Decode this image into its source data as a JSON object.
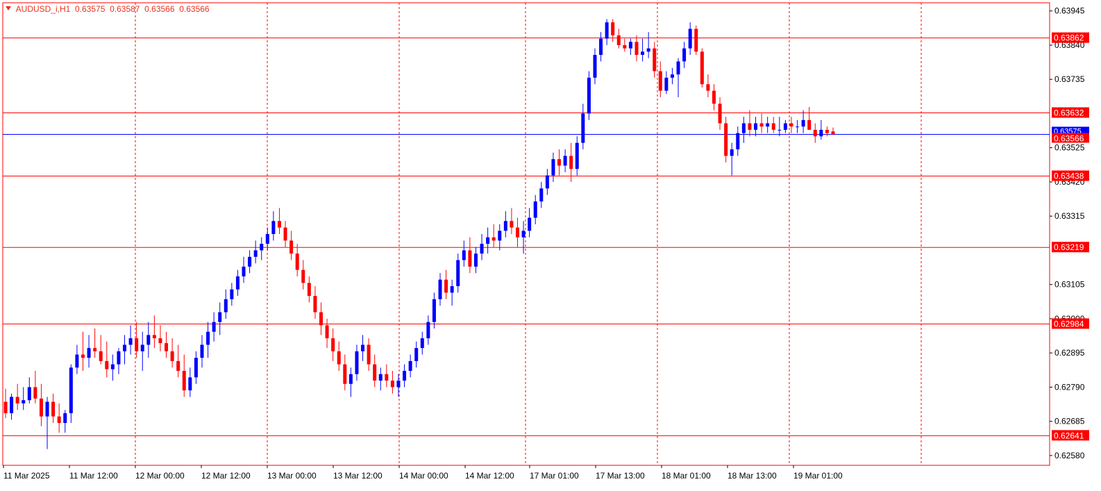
{
  "header": {
    "symbol": "AUDUSD_i,H1",
    "open": "0.63575",
    "high": "0.63587",
    "low": "0.63566",
    "close": "0.63566"
  },
  "colors": {
    "bull": "#0000ff",
    "bear": "#ff0000",
    "grid": "#ff0000",
    "level": "#ff0000",
    "bid": "#0000ff",
    "text": "#000000"
  },
  "chart_data": {
    "type": "candlestick",
    "x_labels": [
      "11 Mar 2025",
      "11 Mar 12:00",
      "12 Mar 00:00",
      "12 Mar 12:00",
      "13 Mar 00:00",
      "13 Mar 12:00",
      "14 Mar 00:00",
      "14 Mar 12:00",
      "17 Mar 01:00",
      "17 Mar 13:00",
      "18 Mar 01:00",
      "18 Mar 13:00",
      "19 Mar 01:00"
    ],
    "y_ticks": [
      0.63945,
      0.6384,
      0.63735,
      0.63525,
      0.6342,
      0.63315,
      0.63105,
      0.63,
      0.62895,
      0.6279,
      0.62685,
      0.6258
    ],
    "ylim": [
      0.6255,
      0.6397
    ],
    "levels": [
      0.63862,
      0.63632,
      0.63438,
      0.63219,
      0.62984,
      0.62641
    ],
    "current_price": 0.63566,
    "current_price_label": "0.63566",
    "current_price_overlapped_label": "0.63575",
    "series": [
      {
        "name": "AUDUSD_i,H1",
        "ohlc": [
          [
            0.62745,
            0.62785,
            0.62695,
            0.6271
          ],
          [
            0.6271,
            0.6277,
            0.6269,
            0.6276
          ],
          [
            0.6276,
            0.628,
            0.6272,
            0.6274
          ],
          [
            0.6274,
            0.6279,
            0.6272,
            0.6275
          ],
          [
            0.6275,
            0.6282,
            0.6274,
            0.6279
          ],
          [
            0.6279,
            0.6284,
            0.6274,
            0.62755
          ],
          [
            0.62755,
            0.628,
            0.6267,
            0.627
          ],
          [
            0.627,
            0.6276,
            0.626,
            0.62745
          ],
          [
            0.62745,
            0.6277,
            0.6268,
            0.627
          ],
          [
            0.627,
            0.6274,
            0.6265,
            0.6268
          ],
          [
            0.6268,
            0.6272,
            0.6265,
            0.6271
          ],
          [
            0.6271,
            0.6286,
            0.6268,
            0.6285
          ],
          [
            0.6285,
            0.6292,
            0.6283,
            0.6289
          ],
          [
            0.6289,
            0.6296,
            0.6284,
            0.6288
          ],
          [
            0.6288,
            0.6295,
            0.6285,
            0.6291
          ],
          [
            0.6291,
            0.6297,
            0.6288,
            0.629
          ],
          [
            0.629,
            0.6295,
            0.6286,
            0.6287
          ],
          [
            0.6287,
            0.6293,
            0.6282,
            0.62845
          ],
          [
            0.62845,
            0.6289,
            0.6281,
            0.6286
          ],
          [
            0.6286,
            0.6291,
            0.6283,
            0.629
          ],
          [
            0.629,
            0.6295,
            0.6286,
            0.6292
          ],
          [
            0.6292,
            0.6298,
            0.6289,
            0.6294
          ],
          [
            0.6294,
            0.6299,
            0.6288,
            0.629
          ],
          [
            0.629,
            0.6296,
            0.6284,
            0.6292
          ],
          [
            0.6292,
            0.6299,
            0.6288,
            0.6295
          ],
          [
            0.6295,
            0.6301,
            0.6291,
            0.6294
          ],
          [
            0.6294,
            0.6298,
            0.629,
            0.62925
          ],
          [
            0.62925,
            0.6296,
            0.6288,
            0.629
          ],
          [
            0.629,
            0.6294,
            0.6285,
            0.6287
          ],
          [
            0.6287,
            0.6292,
            0.6282,
            0.6284
          ],
          [
            0.6284,
            0.6289,
            0.6276,
            0.6278
          ],
          [
            0.6278,
            0.6285,
            0.6276,
            0.6282
          ],
          [
            0.6282,
            0.629,
            0.628,
            0.6288
          ],
          [
            0.6288,
            0.6295,
            0.6285,
            0.6292
          ],
          [
            0.6292,
            0.6299,
            0.6288,
            0.6296
          ],
          [
            0.6296,
            0.6302,
            0.6293,
            0.6299
          ],
          [
            0.6299,
            0.6305,
            0.6295,
            0.6302
          ],
          [
            0.6302,
            0.6309,
            0.63,
            0.6306
          ],
          [
            0.6306,
            0.6311,
            0.6304,
            0.6309
          ],
          [
            0.6309,
            0.6315,
            0.6307,
            0.6313
          ],
          [
            0.6313,
            0.6319,
            0.6311,
            0.6316
          ],
          [
            0.6316,
            0.6321,
            0.6314,
            0.6319
          ],
          [
            0.6319,
            0.6324,
            0.6317,
            0.6321
          ],
          [
            0.6321,
            0.6325,
            0.6318,
            0.6323
          ],
          [
            0.6323,
            0.6328,
            0.6321,
            0.6326
          ],
          [
            0.6326,
            0.6333,
            0.6324,
            0.633
          ],
          [
            0.633,
            0.6334,
            0.6326,
            0.6328
          ],
          [
            0.6328,
            0.633,
            0.6322,
            0.6324
          ],
          [
            0.6324,
            0.6327,
            0.6318,
            0.632
          ],
          [
            0.632,
            0.6323,
            0.6313,
            0.6315
          ],
          [
            0.6315,
            0.6318,
            0.6309,
            0.6311
          ],
          [
            0.6311,
            0.6313,
            0.6305,
            0.6307
          ],
          [
            0.6307,
            0.631,
            0.63,
            0.6302
          ],
          [
            0.6302,
            0.6305,
            0.6295,
            0.6298
          ],
          [
            0.6298,
            0.63,
            0.6291,
            0.6294
          ],
          [
            0.6294,
            0.6297,
            0.6287,
            0.629
          ],
          [
            0.629,
            0.6293,
            0.6284,
            0.6286
          ],
          [
            0.6286,
            0.6289,
            0.6278,
            0.628
          ],
          [
            0.628,
            0.6285,
            0.6276,
            0.6283
          ],
          [
            0.6283,
            0.6292,
            0.6281,
            0.629
          ],
          [
            0.629,
            0.6295,
            0.6287,
            0.6292
          ],
          [
            0.6292,
            0.6294,
            0.6284,
            0.6286
          ],
          [
            0.6286,
            0.6289,
            0.6279,
            0.6281
          ],
          [
            0.6281,
            0.6285,
            0.6278,
            0.6283
          ],
          [
            0.6283,
            0.6286,
            0.6279,
            0.6281
          ],
          [
            0.6281,
            0.6284,
            0.6277,
            0.6279
          ],
          [
            0.6279,
            0.6283,
            0.6276,
            0.6281
          ],
          [
            0.6281,
            0.6286,
            0.6279,
            0.6284
          ],
          [
            0.6284,
            0.6289,
            0.6282,
            0.6287
          ],
          [
            0.6287,
            0.6293,
            0.6285,
            0.6291
          ],
          [
            0.6291,
            0.6296,
            0.6289,
            0.6294
          ],
          [
            0.6294,
            0.6301,
            0.6292,
            0.6299
          ],
          [
            0.6299,
            0.6308,
            0.6297,
            0.6306
          ],
          [
            0.6306,
            0.6314,
            0.6304,
            0.6312
          ],
          [
            0.6312,
            0.6315,
            0.6306,
            0.6308
          ],
          [
            0.6308,
            0.6312,
            0.6304,
            0.631
          ],
          [
            0.631,
            0.632,
            0.6308,
            0.6318
          ],
          [
            0.6318,
            0.6324,
            0.6316,
            0.6321
          ],
          [
            0.6321,
            0.6325,
            0.6314,
            0.6316
          ],
          [
            0.6316,
            0.6322,
            0.6314,
            0.632
          ],
          [
            0.632,
            0.6326,
            0.6318,
            0.6323
          ],
          [
            0.6323,
            0.6328,
            0.632,
            0.6325
          ],
          [
            0.6325,
            0.6329,
            0.6322,
            0.6324
          ],
          [
            0.6324,
            0.6329,
            0.6321,
            0.6327
          ],
          [
            0.6327,
            0.6333,
            0.6325,
            0.633
          ],
          [
            0.633,
            0.6334,
            0.6326,
            0.6328
          ],
          [
            0.6328,
            0.6331,
            0.6322,
            0.6325
          ],
          [
            0.6325,
            0.633,
            0.632,
            0.6327
          ],
          [
            0.6327,
            0.6334,
            0.6325,
            0.6331
          ],
          [
            0.6331,
            0.6338,
            0.6329,
            0.6336
          ],
          [
            0.6336,
            0.6342,
            0.6334,
            0.634
          ],
          [
            0.634,
            0.6346,
            0.6338,
            0.6344
          ],
          [
            0.6344,
            0.6351,
            0.6342,
            0.6349
          ],
          [
            0.6349,
            0.6352,
            0.6344,
            0.6347
          ],
          [
            0.6347,
            0.6352,
            0.6345,
            0.635
          ],
          [
            0.635,
            0.6354,
            0.6342,
            0.6346
          ],
          [
            0.6346,
            0.6356,
            0.6344,
            0.6354
          ],
          [
            0.6354,
            0.6366,
            0.6352,
            0.6363
          ],
          [
            0.6363,
            0.6376,
            0.6361,
            0.6374
          ],
          [
            0.6374,
            0.6383,
            0.6372,
            0.6381
          ],
          [
            0.6381,
            0.6388,
            0.6379,
            0.6386
          ],
          [
            0.6386,
            0.6392,
            0.6384,
            0.6391
          ],
          [
            0.6391,
            0.6392,
            0.6385,
            0.6387
          ],
          [
            0.6387,
            0.6389,
            0.6383,
            0.6384
          ],
          [
            0.6384,
            0.6386,
            0.6382,
            0.6383
          ],
          [
            0.6383,
            0.6386,
            0.6381,
            0.6385
          ],
          [
            0.6385,
            0.6387,
            0.6379,
            0.6381
          ],
          [
            0.6381,
            0.6386,
            0.6379,
            0.6382
          ],
          [
            0.6382,
            0.6388,
            0.638,
            0.6383
          ],
          [
            0.6383,
            0.6385,
            0.6374,
            0.6376
          ],
          [
            0.6376,
            0.6379,
            0.6368,
            0.637
          ],
          [
            0.637,
            0.6376,
            0.6369,
            0.6374
          ],
          [
            0.6374,
            0.6377,
            0.6372,
            0.6375
          ],
          [
            0.6375,
            0.638,
            0.6368,
            0.6379
          ],
          [
            0.6379,
            0.6385,
            0.6377,
            0.6383
          ],
          [
            0.6383,
            0.6391,
            0.6381,
            0.6389
          ],
          [
            0.6389,
            0.639,
            0.6381,
            0.6382
          ],
          [
            0.6382,
            0.6383,
            0.6371,
            0.6372
          ],
          [
            0.6372,
            0.6375,
            0.6368,
            0.637
          ],
          [
            0.637,
            0.6372,
            0.6364,
            0.6366
          ],
          [
            0.6366,
            0.6368,
            0.6358,
            0.636
          ],
          [
            0.636,
            0.6362,
            0.6348,
            0.635
          ],
          [
            0.635,
            0.6354,
            0.6344,
            0.6352
          ],
          [
            0.6352,
            0.6359,
            0.635,
            0.6357
          ],
          [
            0.6357,
            0.6362,
            0.6354,
            0.636
          ],
          [
            0.636,
            0.6364,
            0.6356,
            0.6358
          ],
          [
            0.6358,
            0.6362,
            0.6356,
            0.636
          ],
          [
            0.636,
            0.6363,
            0.6357,
            0.6359
          ],
          [
            0.6359,
            0.6362,
            0.6357,
            0.636
          ],
          [
            0.636,
            0.6362,
            0.6357,
            0.6358
          ],
          [
            0.6358,
            0.6362,
            0.6356,
            0.6358
          ],
          [
            0.6358,
            0.6361,
            0.6357,
            0.636
          ],
          [
            0.636,
            0.6362,
            0.6357,
            0.6359
          ],
          [
            0.6359,
            0.6361,
            0.6357,
            0.6359
          ],
          [
            0.6359,
            0.6364,
            0.6357,
            0.6361
          ],
          [
            0.6361,
            0.6365,
            0.6358,
            0.6358
          ],
          [
            0.6358,
            0.636,
            0.6354,
            0.6356
          ],
          [
            0.6356,
            0.6361,
            0.6355,
            0.6358
          ],
          [
            0.6358,
            0.6359,
            0.6356,
            0.6357
          ],
          [
            0.63575,
            0.63587,
            0.63566,
            0.63566
          ]
        ]
      }
    ],
    "grid": "vertical-dashed",
    "legend": "none"
  }
}
